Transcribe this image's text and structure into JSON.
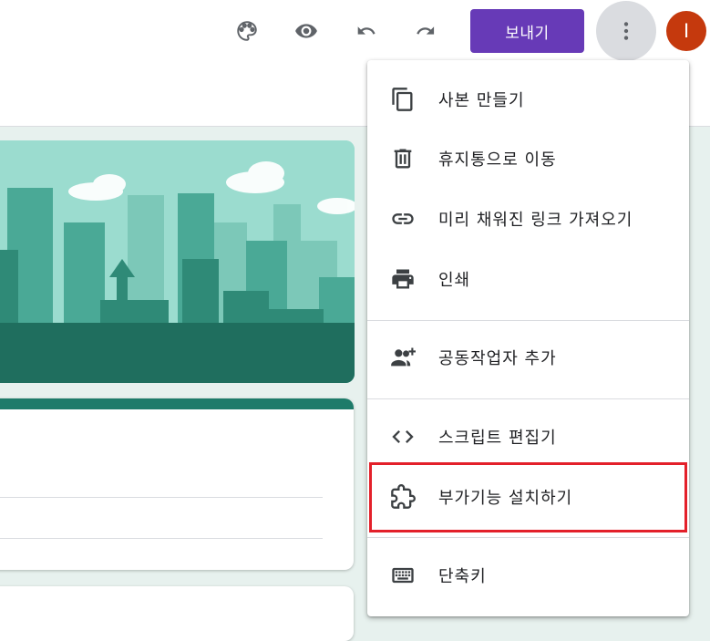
{
  "toolbar": {
    "icons": [
      "palette-icon",
      "eye-icon",
      "undo-icon",
      "redo-icon",
      "more-vert-icon"
    ],
    "send_label": "보내기",
    "avatar_letter": "I"
  },
  "colors": {
    "accent": "#673ab7",
    "avatar": "#c5390d",
    "theme": "#1e7b6a",
    "highlight": "#e3202a",
    "background": "#e7f1ee"
  },
  "menu": {
    "items": [
      {
        "label": "사본 만들기",
        "icon": "copy-icon"
      },
      {
        "label": "휴지통으로 이동",
        "icon": "trash-icon"
      },
      {
        "label": "미리 채워진 링크 가져오기",
        "icon": "link-icon"
      },
      {
        "label": "인쇄",
        "icon": "print-icon"
      },
      {
        "label": "공동작업자 추가",
        "icon": "add-people-icon"
      },
      {
        "label": "스크립트 편집기",
        "icon": "code-icon"
      },
      {
        "label": "부가기능 설치하기",
        "icon": "puzzle-icon"
      },
      {
        "label": "단축키",
        "icon": "keyboard-icon"
      }
    ]
  }
}
